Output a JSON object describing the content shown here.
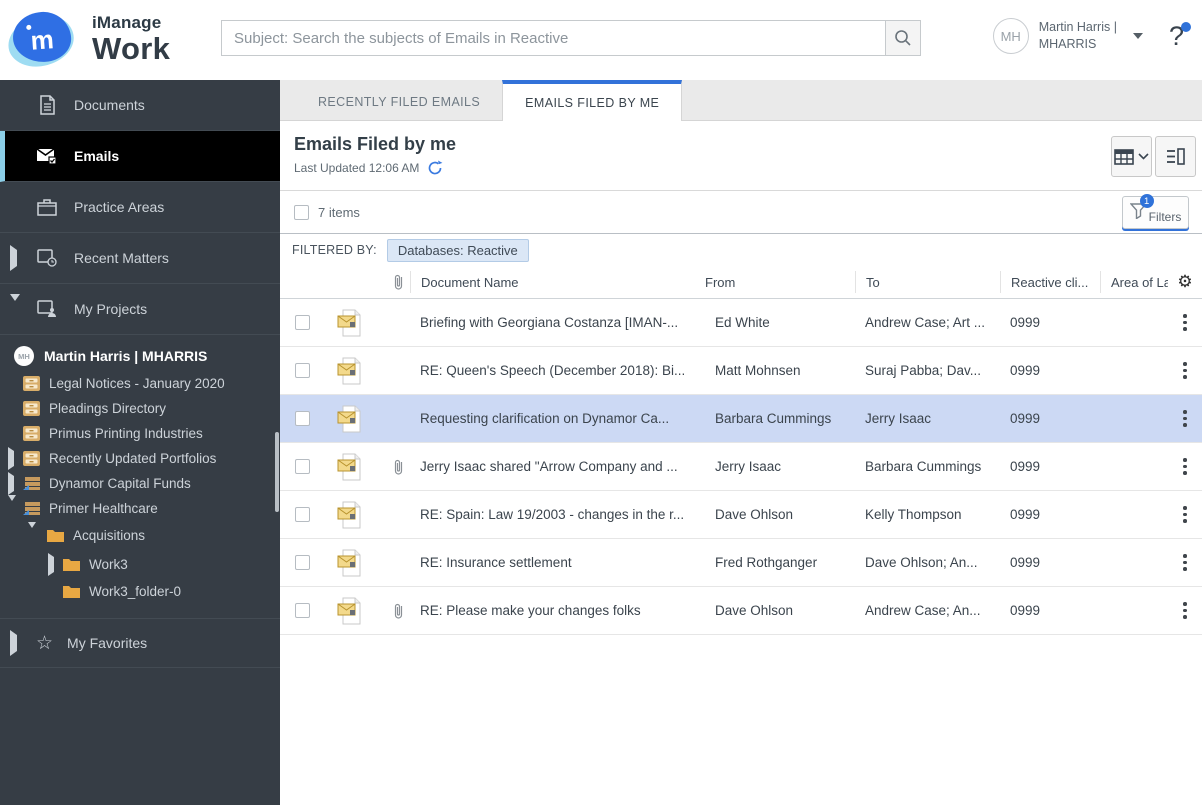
{
  "header": {
    "brand": {
      "line1": "iManage",
      "line2": "Work",
      "m": "m"
    },
    "search": {
      "placeholder": "Subject: Search the subjects of Emails in Reactive"
    },
    "user": {
      "initials": "MH",
      "name": "Martin Harris |",
      "id": "MHARRIS"
    },
    "help_label": "?"
  },
  "sidebar": {
    "items": [
      {
        "label": "Documents"
      },
      {
        "label": "Emails"
      },
      {
        "label": "Practice Areas"
      },
      {
        "label": "Recent Matters"
      },
      {
        "label": "My Projects"
      }
    ],
    "tree": [
      {
        "label": "Martin Harris | MHARRIS",
        "avatar": "MH"
      },
      {
        "label": "Legal Notices - January 2020"
      },
      {
        "label": "Pleadings Directory"
      },
      {
        "label": "Primus Printing Industries"
      },
      {
        "label": "Recently Updated Portfolios"
      },
      {
        "label": "Dynamor Capital Funds"
      },
      {
        "label": "Primer Healthcare"
      },
      {
        "label": "Acquisitions"
      },
      {
        "label": "Work3"
      },
      {
        "label": "Work3_folder-0"
      }
    ],
    "favorites_label": "My Favorites"
  },
  "tabs": [
    {
      "label": "RECENTLY FILED EMAILS"
    },
    {
      "label": "EMAILS FILED BY ME"
    }
  ],
  "main": {
    "title": "Emails Filed by me",
    "last_updated": "Last Updated 12:06 AM",
    "items_count": "7 items",
    "filters_label": "Filters",
    "filters_badge": "1",
    "filtered_by_label": "FILTERED BY:",
    "filter_chip": "Databases: Reactive"
  },
  "table": {
    "columns": [
      "Document Name",
      "From",
      "To",
      "Reactive cli...",
      "Area of La"
    ],
    "rows": [
      {
        "name": "Briefing with Georgiana Costanza [IMAN-...",
        "from": "Ed White",
        "to": "Andrew Case; Art ...",
        "client": "0999"
      },
      {
        "name": "RE: Queen's Speech (December 2018): Bi...",
        "from": "Matt Mohnsen",
        "to": "Suraj Pabba; Dav...",
        "client": "0999"
      },
      {
        "name": "Requesting clarification on Dynamor Ca...",
        "from": "Barbara Cummings",
        "to": "Jerry Isaac",
        "client": "0999"
      },
      {
        "name": "Jerry Isaac shared \"Arrow Company and ...",
        "from": "Jerry Isaac",
        "to": "Barbara Cummings",
        "client": "0999"
      },
      {
        "name": "RE: Spain: Law 19/2003 - changes in the r...",
        "from": "Dave Ohlson",
        "to": "Kelly Thompson",
        "client": "0999"
      },
      {
        "name": "RE: Insurance settlement",
        "from": "Fred Rothganger",
        "to": "Dave Ohlson; An...",
        "client": "0999"
      },
      {
        "name": "RE: Please make your changes folks",
        "from": "Dave Ohlson",
        "to": "Andrew Case; An...",
        "client": "0999"
      }
    ]
  },
  "colors": {
    "accent_blue": "#3272d9",
    "badge_blue": "#2f72d9",
    "sidebar_bg": "#363d45",
    "active_item_bg": "#000000",
    "active_item_border": "#8ccfe8",
    "selected_row_bg": "#ccd9f4",
    "chip_bg": "#dbe7f6",
    "chip_border": "#b3cbe6",
    "folder_tan": "#e8a843",
    "logo_blue": "#2f6fe4",
    "logo_light_blue": "#9edcf2"
  }
}
